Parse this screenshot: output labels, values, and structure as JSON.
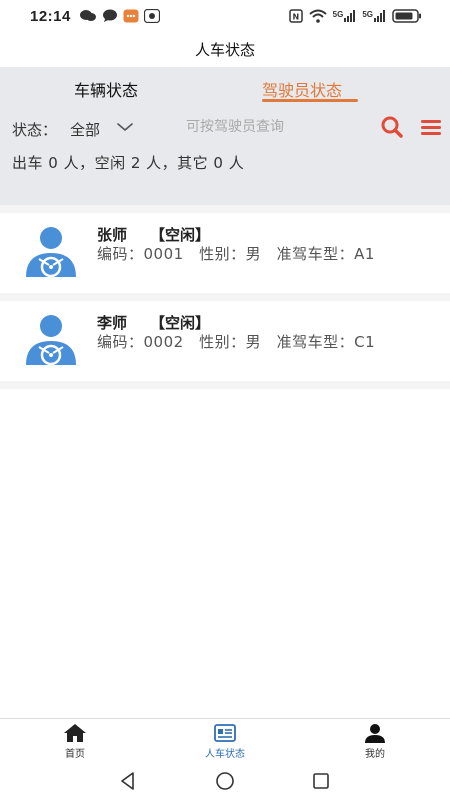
{
  "status_bar": {
    "time": "12:14",
    "network_5g_a": "5G",
    "network_5g_b": "5G"
  },
  "header": {
    "title": "人车状态"
  },
  "tabs": [
    {
      "label": "车辆状态",
      "active": false
    },
    {
      "label": "驾驶员状态",
      "active": true
    }
  ],
  "filter": {
    "label": "状态：",
    "value": "全部",
    "search_placeholder": "可按驾驶员查询"
  },
  "summary": "出车 0 人，空闲 2 人，其它 0 人",
  "drivers": [
    {
      "name": "张师",
      "status": "【空闲】",
      "info": "编码：0001　性别：男　准驾车型：A1"
    },
    {
      "name": "李师",
      "status": "【空闲】",
      "info": "编码：0002　性别：男　准驾车型：C1"
    }
  ],
  "bottom_nav": [
    {
      "label": "首页",
      "icon": "home-icon",
      "active": false
    },
    {
      "label": "人车状态",
      "icon": "status-card-icon",
      "active": true
    },
    {
      "label": "我的",
      "icon": "person-icon",
      "active": false
    }
  ],
  "colors": {
    "accent": "#e07a3a",
    "panel": "#e8e9ed",
    "nav_active": "#2e6fb4",
    "avatar": "#4a90d9",
    "danger": "#e04b3a"
  }
}
